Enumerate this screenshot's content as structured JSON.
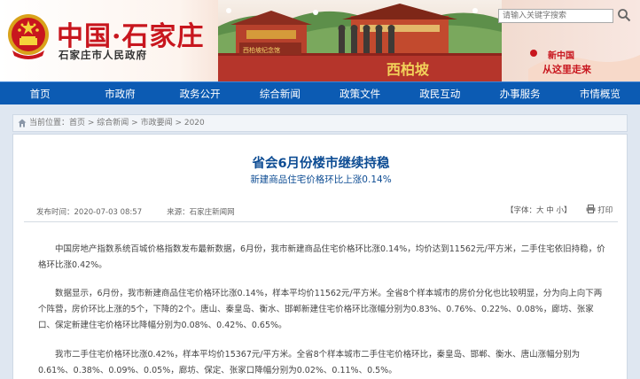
{
  "header": {
    "site_title": "中国·石家庄",
    "site_subtitle": "石家庄市人民政府",
    "search_placeholder": "请输入关键字搜索"
  },
  "nav": {
    "items": [
      {
        "label": "首页"
      },
      {
        "label": "市政府"
      },
      {
        "label": "政务公开"
      },
      {
        "label": "综合新闻"
      },
      {
        "label": "政策文件"
      },
      {
        "label": "政民互动"
      },
      {
        "label": "办事服务"
      },
      {
        "label": "市情概览"
      }
    ]
  },
  "breadcrumb": {
    "prefix": "当前位置：",
    "items": [
      "首页",
      "综合新闻",
      "市政要闻",
      "2020"
    ],
    "separator": " > "
  },
  "article": {
    "title": "省会6月份楼市继续持稳",
    "subtitle": "新建商品住宅价格环比上涨0.14%",
    "publish_time": "发布时间：2020-07-03 08:57",
    "source": "来源：石家庄新闻网",
    "font_label": "【字体：",
    "font_large": "大",
    "font_medium": "中",
    "font_small": "小",
    "font_close": "】",
    "print_label": "打印",
    "paragraphs": [
      "中国房地产指数系统百城价格指数发布最新数据，6月份，我市新建商品住宅价格环比涨0.14%，均价达到11562元/平方米，二手住宅依旧持稳，价格环比涨0.42%。",
      "数据显示，6月份，我市新建商品住宅价格环比涨0.14%，样本平均价11562元/平方米。全省8个样本城市的房价分化也比较明显，分为向上向下两个阵营，房价环比上涨的5个，下降的2个。唐山、秦皇岛、衡水、邯郸新建住宅价格环比涨幅分别为0.83%、0.76%、0.22%、0.08%，廊坊、张家口、保定新建住宅价格环比降幅分别为0.08%、0.42%、0.65%。",
      "我市二手住宅价格环比涨0.42%，样本平均价15367元/平方米。全省8个样本城市二手住宅价格环比，秦皇岛、邯郸、衡水、唐山涨幅分别为0.61%、0.38%、0.09%、0.05%，廊坊、保定、张家口降幅分别为0.02%、0.11%、0.5%。"
    ]
  },
  "colors": {
    "nav_bg": "#0c5bb3",
    "title_blue": "#0d4c93",
    "brand_red": "#c8161e",
    "page_bg": "#dfe7f1"
  },
  "icons": {
    "emblem": "national-emblem-icon",
    "search": "search-icon",
    "home": "home-icon",
    "print": "print-icon"
  }
}
